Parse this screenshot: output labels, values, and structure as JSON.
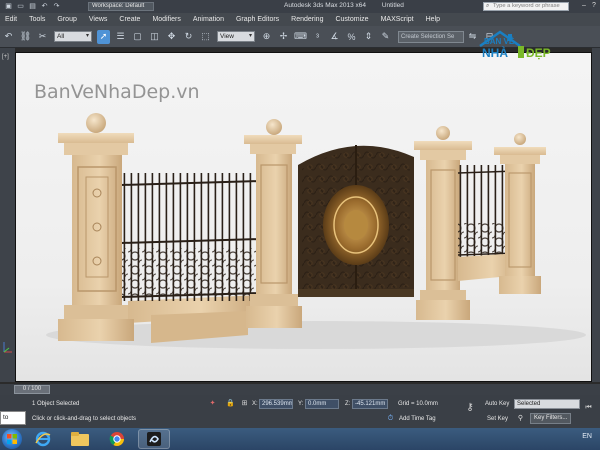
{
  "titlebar": {
    "workspace": "Workspace: Default",
    "app_title": "Autodesk 3ds Max  2013 x64",
    "file_name": "Untitled",
    "search_placeholder": "Type a keyword or phrase"
  },
  "menu": [
    "Edit",
    "Tools",
    "Group",
    "Views",
    "Create",
    "Modifiers",
    "Animation",
    "Graph Editors",
    "Rendering",
    "Customize",
    "MAXScript",
    "Help"
  ],
  "toolbar": {
    "selection_filter": "All",
    "ref_coord": "View",
    "selection_set_placeholder": "Create Selection Se"
  },
  "viewport": {
    "label": "[+]",
    "watermark": "BanVeNhaDep.vn"
  },
  "logo": {
    "line1": "BẢN VẼ",
    "line2_left": "NHÀ",
    "line2_right": "ĐẸP",
    "color_blue": "#1a7fc2",
    "color_green": "#7ab929"
  },
  "timeslider": {
    "frame": "0 / 100"
  },
  "status": {
    "selected": "1 Object Selected",
    "prompt": "Click or click-and-drag to select objects",
    "x_label": "X:",
    "x_value": "296.539mm",
    "y_label": "Y:",
    "y_value": "0.0mm",
    "z_label": "Z:",
    "z_value": "-45.121mm",
    "grid": "Grid = 10.0mm",
    "add_time_tag": "Add Time Tag",
    "auto_key": "Auto Key",
    "auto_key_value": "Selected",
    "set_key": "Set Key",
    "key_filters": "Key Filters...",
    "maxscript_text": "to "
  },
  "taskbar": {
    "lang": "EN"
  },
  "colors": {
    "ui_dark": "#3a3f46",
    "accent": "#4f93d6",
    "stone": "#e3c9a3",
    "iron": "#2a2018",
    "gold": "#a67a3c"
  }
}
